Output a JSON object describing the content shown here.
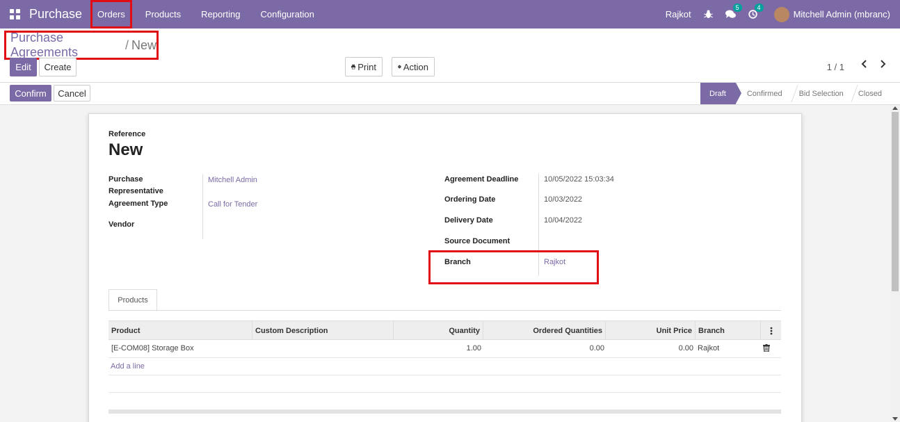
{
  "navbar": {
    "app_name": "Purchase",
    "menu": [
      "Orders",
      "Products",
      "Reporting",
      "Configuration"
    ],
    "branch": "Rajkot",
    "messages_count": "5",
    "activities_count": "4",
    "user": "Mitchell Admin (mbranc)"
  },
  "breadcrumb": {
    "parent": "Purchase Agreements",
    "separator": "/",
    "current": "New"
  },
  "toolbar": {
    "edit_label": "Edit",
    "create_label": "Create",
    "print_label": "Print",
    "action_label": "Action",
    "pager": "1 / 1"
  },
  "statusbar": {
    "confirm_label": "Confirm",
    "cancel_label": "Cancel",
    "stages": [
      "Draft",
      "Confirmed",
      "Bid Selection",
      "Closed"
    ],
    "active_stage": "Draft"
  },
  "form": {
    "reference_label": "Reference",
    "reference_value": "New",
    "left_fields": [
      {
        "label": "Purchase Representative",
        "value": "Mitchell Admin"
      },
      {
        "label": "Agreement Type",
        "value": "Call for Tender"
      },
      {
        "label": "Vendor",
        "value": ""
      }
    ],
    "right_fields": [
      {
        "label": "Agreement Deadline",
        "value": "10/05/2022 15:03:34"
      },
      {
        "label": "Ordering Date",
        "value": "10/03/2022"
      },
      {
        "label": "Delivery Date",
        "value": "10/04/2022"
      },
      {
        "label": "Source Document",
        "value": ""
      },
      {
        "label": "Branch",
        "value": "Rajkot"
      }
    ]
  },
  "tabs": [
    "Products"
  ],
  "table": {
    "columns": [
      "Product",
      "Custom Description",
      "Quantity",
      "Ordered Quantities",
      "Unit Price",
      "Branch"
    ],
    "rows": [
      {
        "product": "[E-COM08] Storage Box",
        "description": "",
        "quantity": "1.00",
        "ordered": "0.00",
        "unit_price": "0.00",
        "branch": "Rajkot"
      }
    ],
    "add_line": "Add a line"
  },
  "colors": {
    "brand": "#7c6aa6",
    "highlight": "#e10d14"
  }
}
